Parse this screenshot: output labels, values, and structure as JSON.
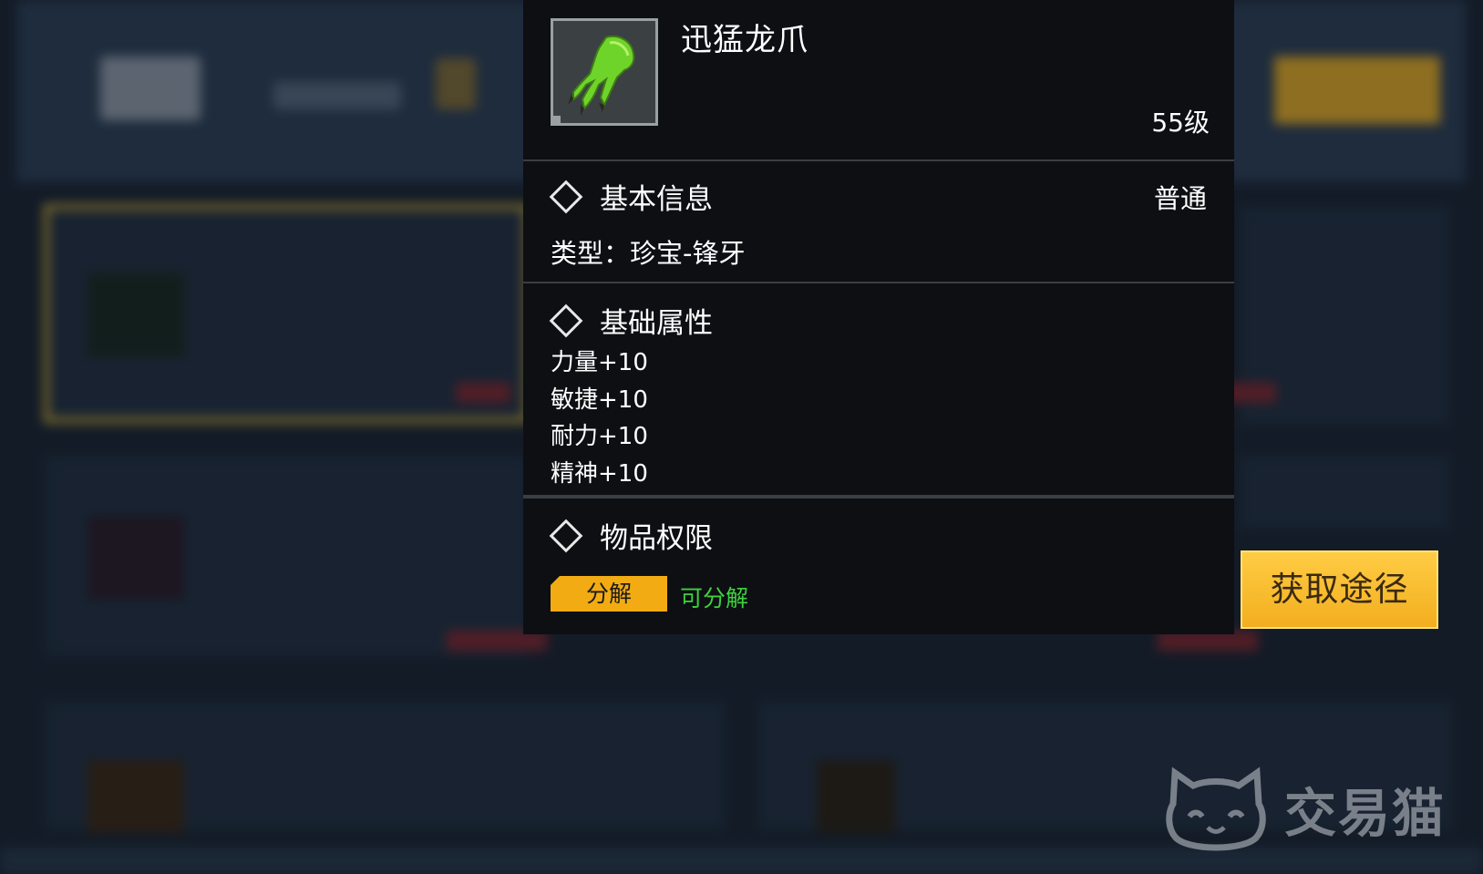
{
  "item": {
    "name": "迅猛龙爪",
    "level": "55级",
    "icon": "green-claw-icon"
  },
  "basic_info": {
    "title": "基本信息",
    "quality": "普通",
    "type_line": "类型：珍宝-锋牙"
  },
  "base_attributes": {
    "title": "基础属性",
    "lines": [
      "力量+10",
      "敏捷+10",
      "耐力+10",
      "精神+10"
    ]
  },
  "permissions": {
    "title": "物品权限",
    "badge": "分解",
    "status": "可分解"
  },
  "acquire_button": "获取途径",
  "watermark": "交易猫",
  "colors": {
    "panel_bg": "#0d0f13",
    "accent_yellow": "#f2ab13",
    "status_green": "#3fd13f"
  }
}
